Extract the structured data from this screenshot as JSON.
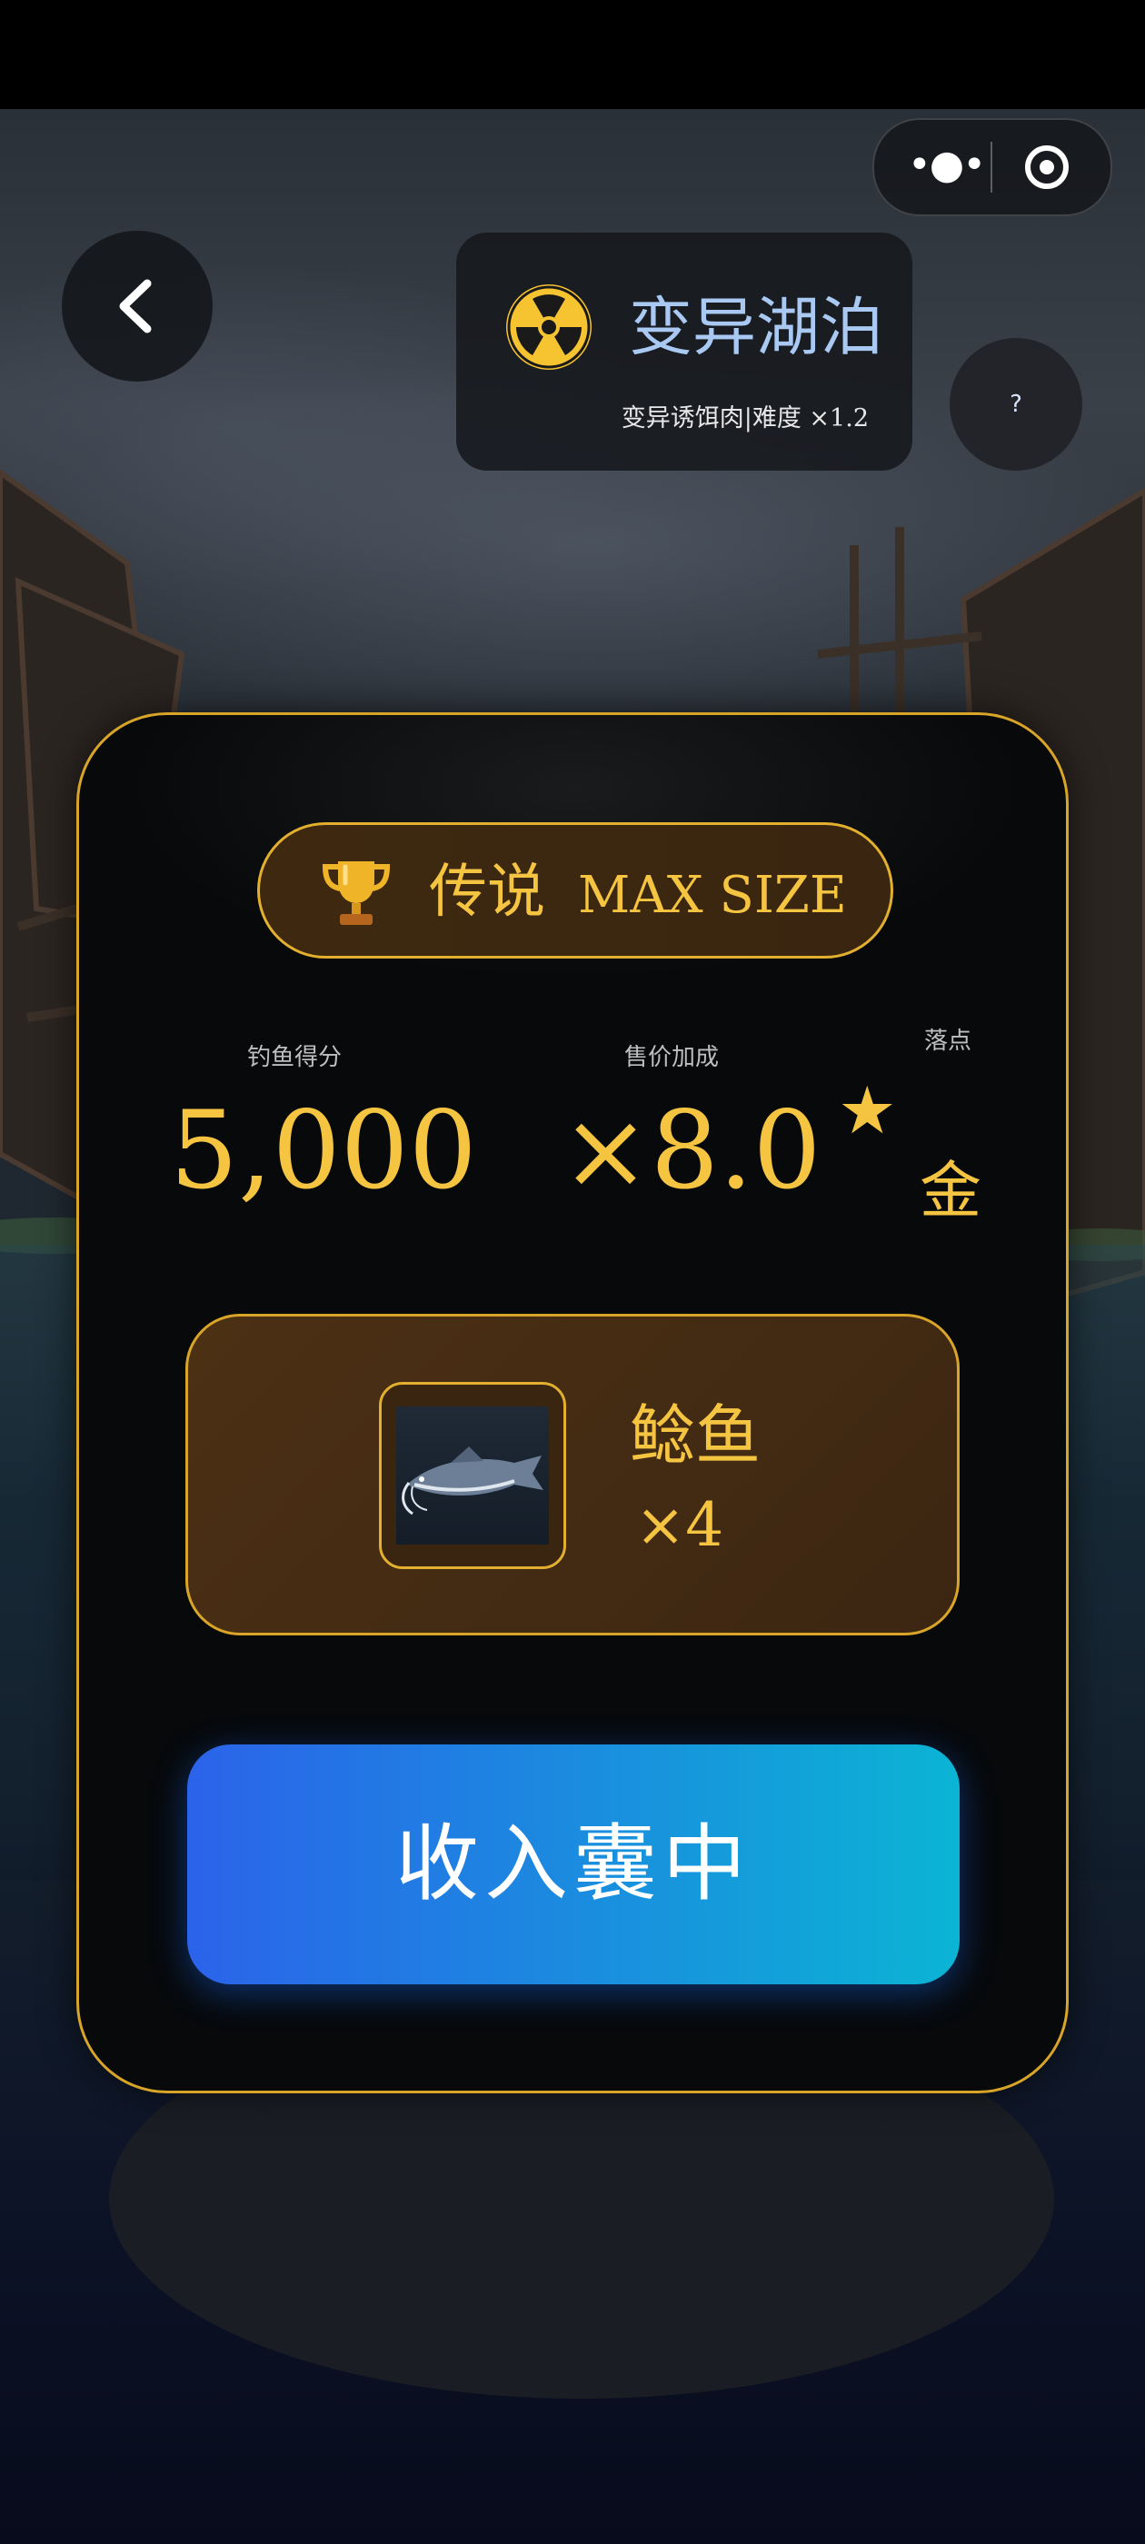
{
  "topbar": {
    "more_icon": "more-dots-icon",
    "close_icon": "target-circle-icon"
  },
  "header": {
    "back_icon": "chevron-left-icon",
    "location_icon": "radiation-icon",
    "title": "变异湖泊",
    "subtitle": "变异诱饵肉|难度 ×1.2",
    "help_label": "?"
  },
  "result": {
    "rank_icon": "trophy-icon",
    "rank": "传说",
    "size_tag": "MAX SIZE",
    "score_label": "钓鱼得分",
    "score_value": "5,000",
    "bonus_label": "售价加成",
    "bonus_value": "×8.0",
    "landing_label": "落点",
    "landing_star": "★",
    "landing_grade": "金"
  },
  "catch": {
    "fish_image": "catfish-image",
    "fish_name": "鲶鱼",
    "fish_count": "×4"
  },
  "actions": {
    "collect_label": "收入囊中"
  },
  "colors": {
    "accent_gold": "#f5c542",
    "border_gold": "#d8a528",
    "title_blue": "#a9c9f2",
    "button_start": "#2b63ea",
    "button_end": "#0bb4d4"
  }
}
